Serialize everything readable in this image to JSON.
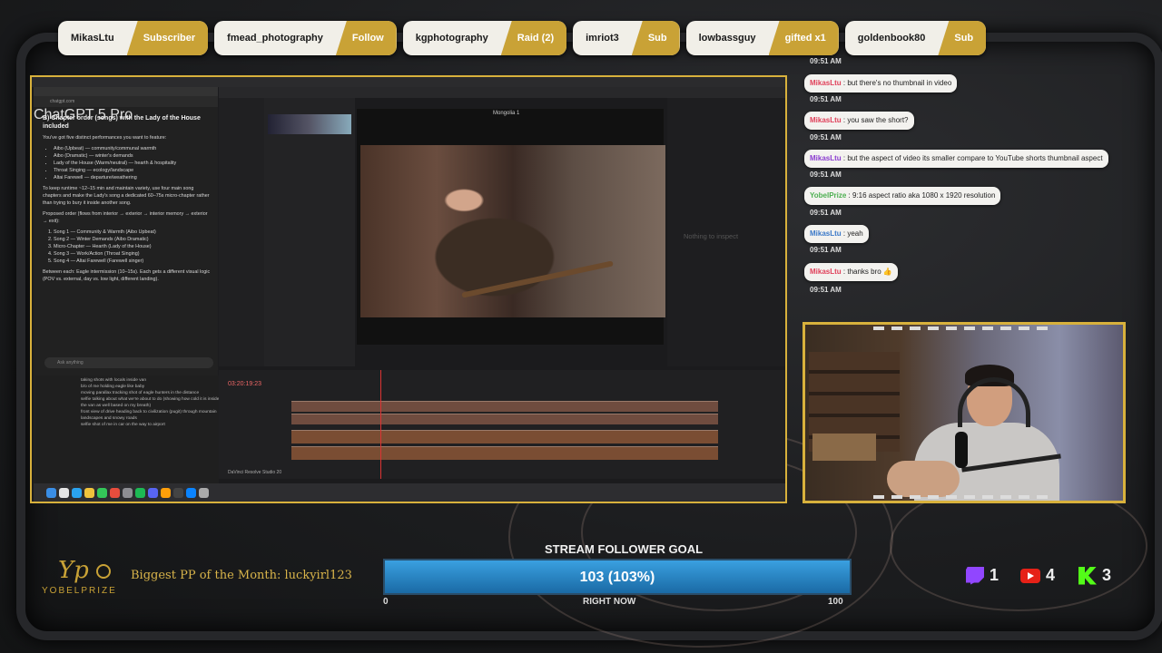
{
  "alerts": [
    {
      "name": "MikasLtu",
      "type": "Subscriber"
    },
    {
      "name": "fmead_photography",
      "type": "Follow"
    },
    {
      "name": "kgphotography",
      "type": "Raid (2)"
    },
    {
      "name": "imriot3",
      "type": "Sub"
    },
    {
      "name": "lowbassguy",
      "type": "gifted x1"
    },
    {
      "name": "goldenbook80",
      "type": "Sub"
    }
  ],
  "screen": {
    "chatgpt": {
      "title": "ChatGPT 5 Pro",
      "heading": "B) Chapter order (songs) with the Lady of the House included",
      "intro": "You've got five distinct performances you want to feature:",
      "features": [
        "Aibo (Upbeat) — community/communal warmth",
        "Aibo (Dramatic) — winter's demands",
        "Lady of the House (Warm/neutral) — hearth & hospitality",
        "Throat Singing — ecology/landscape",
        "Altai Farewell — departure/weathering"
      ],
      "keep": "To keep runtime ~12–15 min and maintain variety, use four main song chapters and make the Lady's song a dedicated 60–75s micro-chapter rather than trying to bury it inside another song.",
      "proposed": "Proposed order (flows from interior → exterior → interior memory → exterior → exit):",
      "order": [
        "Song 1 — Community & Warmth (Aibo Upbeat)",
        "Song 2 — Winter Demands (Aibo Dramatic)",
        "Micro-Chapter — Hearth (Lady of the House)",
        "Song 3 — Work/Action (Throat Singing)",
        "Song 4 — Altai Farewell (Farewell singer)"
      ],
      "between": "Between each: Eagle intermission (10–15s). Each gets a different visual logic (POV vs. external, day vs. low light, different landing).",
      "ask_placeholder": "Ask anything"
    },
    "notes": [
      "taking shots with locals inside van",
      "b/o of me holding eagle like baby",
      "moving parallax tracking shot of eagle hunters in the distance",
      "selfie talking about what we're about to do (showing how cold it is inside the van as well based on my breath)",
      "front view of drive heading back to civilization (pugit) through mountain landscapes and snowy roads",
      "selfie shot of me in car on the way to airport"
    ],
    "resolve": {
      "timeline_name": "Mongolia 1",
      "timecode": "03:20:19:23",
      "inspector_empty": "Nothing to inspect",
      "app_label": "DaVinci Resolve Studio 20"
    }
  },
  "chat": [
    {
      "time": "09:51 AM"
    },
    {
      "user": "MikasLtu",
      "user_color": "#e0405a",
      "text": "but there's no thumbnail in video",
      "time": "09:51 AM"
    },
    {
      "user": "MikasLtu",
      "user_color": "#e0405a",
      "text": "you saw the short?",
      "time": "09:51 AM"
    },
    {
      "user": "MikasLtu",
      "user_color": "#8a3cd0",
      "text": "but the aspect of video its smaller compare to YouTube shorts thumbnail aspect",
      "time": "09:51 AM"
    },
    {
      "user": "YobelPrize",
      "user_color": "#4caf50",
      "text": "9:16 aspect ratio aka 1080 x 1920 resolution",
      "time": "09:51 AM"
    },
    {
      "user": "MikasLtu",
      "user_color": "#3a78c8",
      "text": "yeah",
      "time": "09:51 AM"
    },
    {
      "user": "MikasLtu",
      "user_color": "#e0405a",
      "text": "thanks bro 👍",
      "time": "09:51 AM"
    }
  ],
  "branding": {
    "logo_word": "YOBELPRIZE",
    "accent": "#c9a236"
  },
  "pp_banner": "Biggest PP of the Month: luckyirl123",
  "goal": {
    "title": "STREAM FOLLOWER GOAL",
    "label": "103 (103%)",
    "current": 103,
    "target": 100,
    "fill_fraction": 1.0,
    "min_label": "0",
    "max_label": "100",
    "sub_label": "RIGHT NOW"
  },
  "socials": [
    {
      "icon": "twitch-icon",
      "count": "1"
    },
    {
      "icon": "youtube-icon",
      "count": "4"
    },
    {
      "icon": "kick-icon",
      "count": "3"
    }
  ]
}
